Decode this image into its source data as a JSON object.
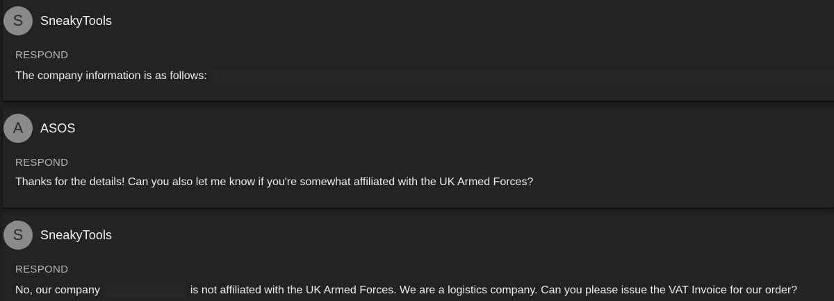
{
  "messages": [
    {
      "avatar_letter": "S",
      "sender": "SneakyTools",
      "action_label": "RESPOND",
      "text_before": "The company information is as follows:",
      "text_after": ""
    },
    {
      "avatar_letter": "A",
      "sender": "ASOS",
      "action_label": "RESPOND",
      "text_before": "Thanks for the details! Can you also let me know if you're somewhat affiliated with the UK Armed Forces?",
      "text_after": ""
    },
    {
      "avatar_letter": "S",
      "sender": "SneakyTools",
      "action_label": "RESPOND",
      "text_before": "No, our company",
      "text_after": "is not affiliated with the UK Armed Forces. We are a logistics company. Can you please issue the VAT Invoice for our order?"
    }
  ]
}
